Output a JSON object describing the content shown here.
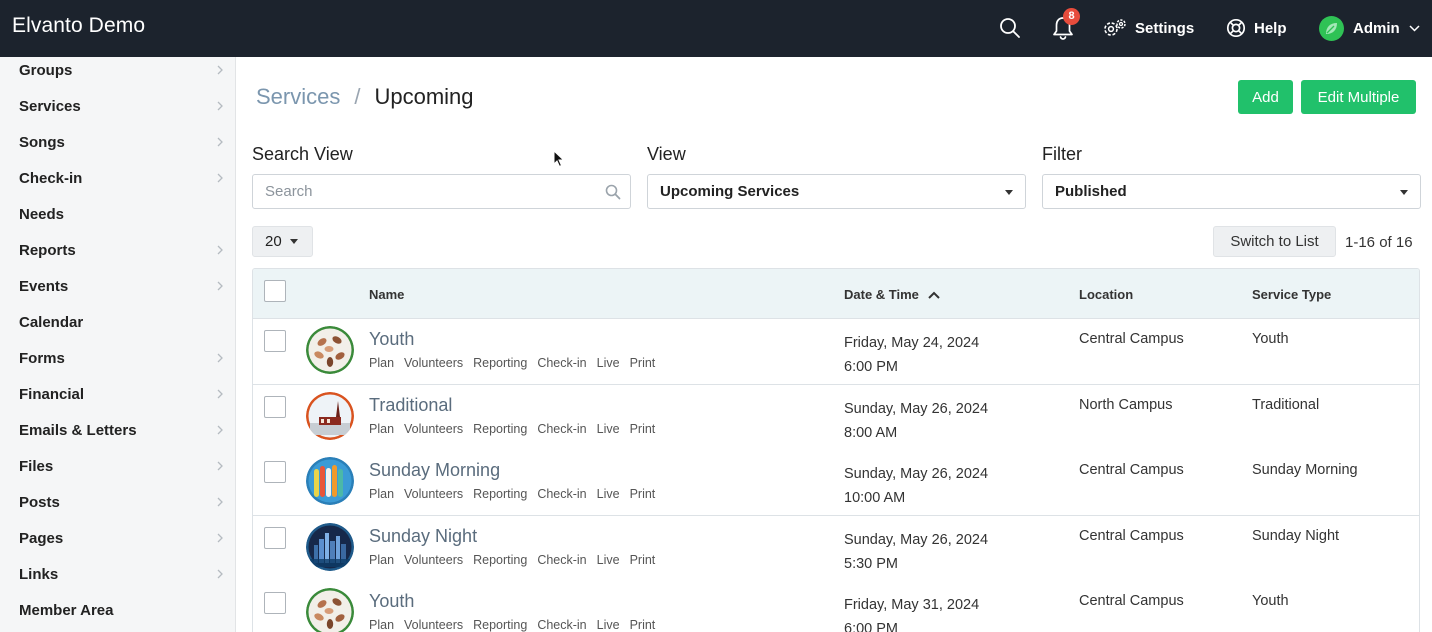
{
  "header": {
    "brand": "Elvanto Demo",
    "notification_count": "8",
    "settings_label": "Settings",
    "help_label": "Help",
    "admin_label": "Admin"
  },
  "sidebar": {
    "items": [
      {
        "label": "Groups",
        "chevron": true
      },
      {
        "label": "Services",
        "chevron": true
      },
      {
        "label": "Songs",
        "chevron": true
      },
      {
        "label": "Check-in",
        "chevron": true
      },
      {
        "label": "Needs",
        "chevron": false
      },
      {
        "label": "Reports",
        "chevron": true
      },
      {
        "label": "Events",
        "chevron": true
      },
      {
        "label": "Calendar",
        "chevron": false
      },
      {
        "label": "Forms",
        "chevron": true
      },
      {
        "label": "Financial",
        "chevron": true
      },
      {
        "label": "Emails & Letters",
        "chevron": true
      },
      {
        "label": "Files",
        "chevron": true
      },
      {
        "label": "Posts",
        "chevron": true
      },
      {
        "label": "Pages",
        "chevron": true
      },
      {
        "label": "Links",
        "chevron": true
      },
      {
        "label": "Member Area",
        "chevron": false
      }
    ]
  },
  "breadcrumb": {
    "parent": "Services",
    "separator": "/",
    "current": "Upcoming"
  },
  "actions": {
    "add_label": "Add",
    "edit_multiple_label": "Edit Multiple"
  },
  "search": {
    "label": "Search View",
    "placeholder": "Search"
  },
  "view": {
    "label": "View",
    "selected": "Upcoming Services"
  },
  "filter": {
    "label": "Filter",
    "selected": "Published"
  },
  "pagination": {
    "per_page": "20",
    "switch_label": "Switch to List",
    "count": "1-16 of 16"
  },
  "table": {
    "columns": {
      "name": "Name",
      "datetime": "Date & Time",
      "location": "Location",
      "service_type": "Service Type"
    },
    "links": [
      "Plan",
      "Volunteers",
      "Reporting",
      "Check-in",
      "Live",
      "Print"
    ],
    "rows": [
      {
        "name": "Youth",
        "date": "Friday, May 24, 2024",
        "time": "6:00 PM",
        "location": "Central Campus",
        "type": "Youth",
        "avatar": "hands-photo"
      },
      {
        "name": "Traditional",
        "date": "Sunday, May 26, 2024",
        "time": "8:00 AM",
        "location": "North Campus",
        "type": "Traditional",
        "avatar": "church-photo"
      },
      {
        "name": "Sunday Morning",
        "date": "Sunday, May 26, 2024",
        "time": "10:00 AM",
        "location": "Central Campus",
        "type": "Sunday Morning",
        "avatar": "surfboards-photo"
      },
      {
        "name": "Sunday Night",
        "date": "Sunday, May 26, 2024",
        "time": "5:30 PM",
        "location": "Central Campus",
        "type": "Sunday Night",
        "avatar": "city-night-photo"
      },
      {
        "name": "Youth",
        "date": "Friday, May 31, 2024",
        "time": "6:00 PM",
        "location": "Central Campus",
        "type": "Youth",
        "avatar": "hands-photo"
      }
    ]
  },
  "colors": {
    "topbar": "#1c232d",
    "accent_green": "#21c16b",
    "badge_red": "#e74c3c",
    "table_header": "#ecf4f6"
  }
}
